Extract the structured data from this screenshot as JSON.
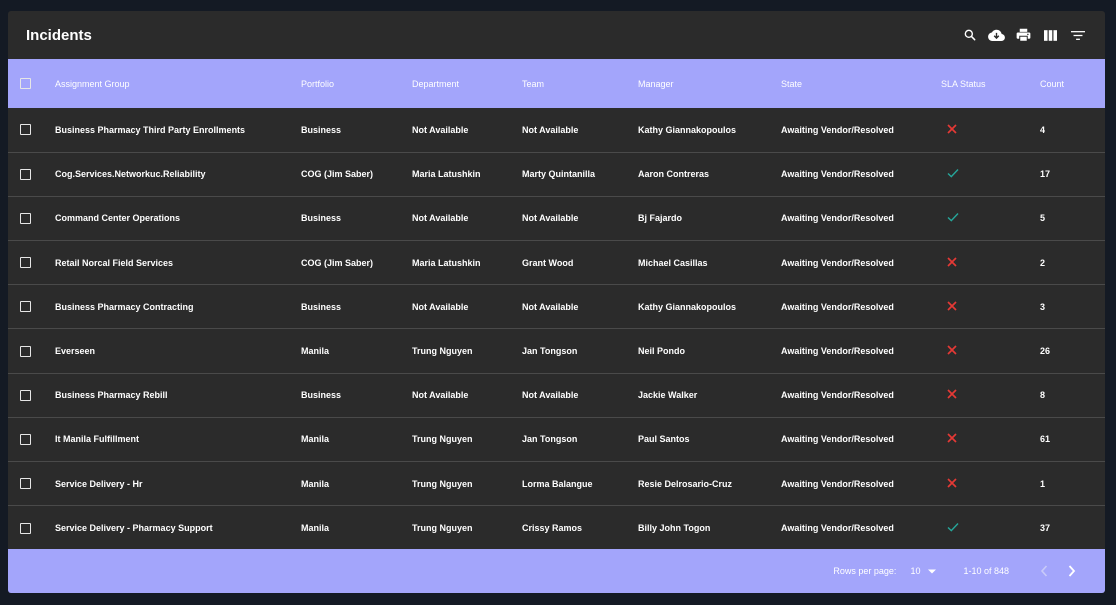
{
  "header": {
    "title": "Incidents",
    "tools": [
      "search-icon",
      "cloud-download-icon",
      "print-icon",
      "view-column-icon",
      "filter-list-icon"
    ]
  },
  "table": {
    "columns": [
      "Assignment Group",
      "Portfolio",
      "Department",
      "Team",
      "Manager",
      "State",
      "SLA Status",
      "Count"
    ],
    "rows": [
      {
        "assignment_group": "Business Pharmacy Third Party Enrollments",
        "portfolio": "Business",
        "department": "Not Available",
        "team": "Not Available",
        "manager": "Kathy Giannakopoulos",
        "state": "Awaiting Vendor/Resolved",
        "sla": "breached",
        "count": "4"
      },
      {
        "assignment_group": "Cog.Services.Networkuc.Reliability",
        "portfolio": "COG (Jim Saber)",
        "department": "Maria Latushkin",
        "team": "Marty Quintanilla",
        "manager": "Aaron Contreras",
        "state": "Awaiting Vendor/Resolved",
        "sla": "met",
        "count": "17"
      },
      {
        "assignment_group": "Command Center Operations",
        "portfolio": "Business",
        "department": "Not Available",
        "team": "Not Available",
        "manager": "Bj Fajardo",
        "state": "Awaiting Vendor/Resolved",
        "sla": "met",
        "count": "5"
      },
      {
        "assignment_group": "Retail Norcal Field Services",
        "portfolio": "COG (Jim Saber)",
        "department": "Maria Latushkin",
        "team": "Grant Wood",
        "manager": "Michael Casillas",
        "state": "Awaiting Vendor/Resolved",
        "sla": "breached",
        "count": "2"
      },
      {
        "assignment_group": "Business Pharmacy Contracting",
        "portfolio": "Business",
        "department": "Not Available",
        "team": "Not Available",
        "manager": "Kathy Giannakopoulos",
        "state": "Awaiting Vendor/Resolved",
        "sla": "breached",
        "count": "3"
      },
      {
        "assignment_group": "Everseen",
        "portfolio": "Manila",
        "department": "Trung Nguyen",
        "team": "Jan Tongson",
        "manager": "Neil Pondo",
        "state": "Awaiting Vendor/Resolved",
        "sla": "breached",
        "count": "26"
      },
      {
        "assignment_group": "Business Pharmacy Rebill",
        "portfolio": "Business",
        "department": "Not Available",
        "team": "Not Available",
        "manager": "Jackie Walker",
        "state": "Awaiting Vendor/Resolved",
        "sla": "breached",
        "count": "8"
      },
      {
        "assignment_group": "It Manila Fulfillment",
        "portfolio": "Manila",
        "department": "Trung Nguyen",
        "team": "Jan Tongson",
        "manager": "Paul Santos",
        "state": "Awaiting Vendor/Resolved",
        "sla": "breached",
        "count": "61"
      },
      {
        "assignment_group": "Service Delivery - Hr",
        "portfolio": "Manila",
        "department": "Trung Nguyen",
        "team": "Lorma Balangue",
        "manager": "Resie Delrosario-Cruz",
        "state": "Awaiting Vendor/Resolved",
        "sla": "breached",
        "count": "1"
      },
      {
        "assignment_group": "Service Delivery - Pharmacy Support",
        "portfolio": "Manila",
        "department": "Trung Nguyen",
        "team": "Crissy Ramos",
        "manager": "Billy John Togon",
        "state": "Awaiting Vendor/Resolved",
        "sla": "met",
        "count": "37"
      }
    ]
  },
  "pagination": {
    "rows_per_page_label": "Rows per page:",
    "rows_per_page_value": "10",
    "range_label": "1-10 of 848"
  },
  "colors": {
    "header_bg": "#a3a5fb",
    "panel_bg": "#2b2b2b",
    "page_bg": "#141a24",
    "sla_breached": "#e53935",
    "sla_met": "#26a69a"
  }
}
